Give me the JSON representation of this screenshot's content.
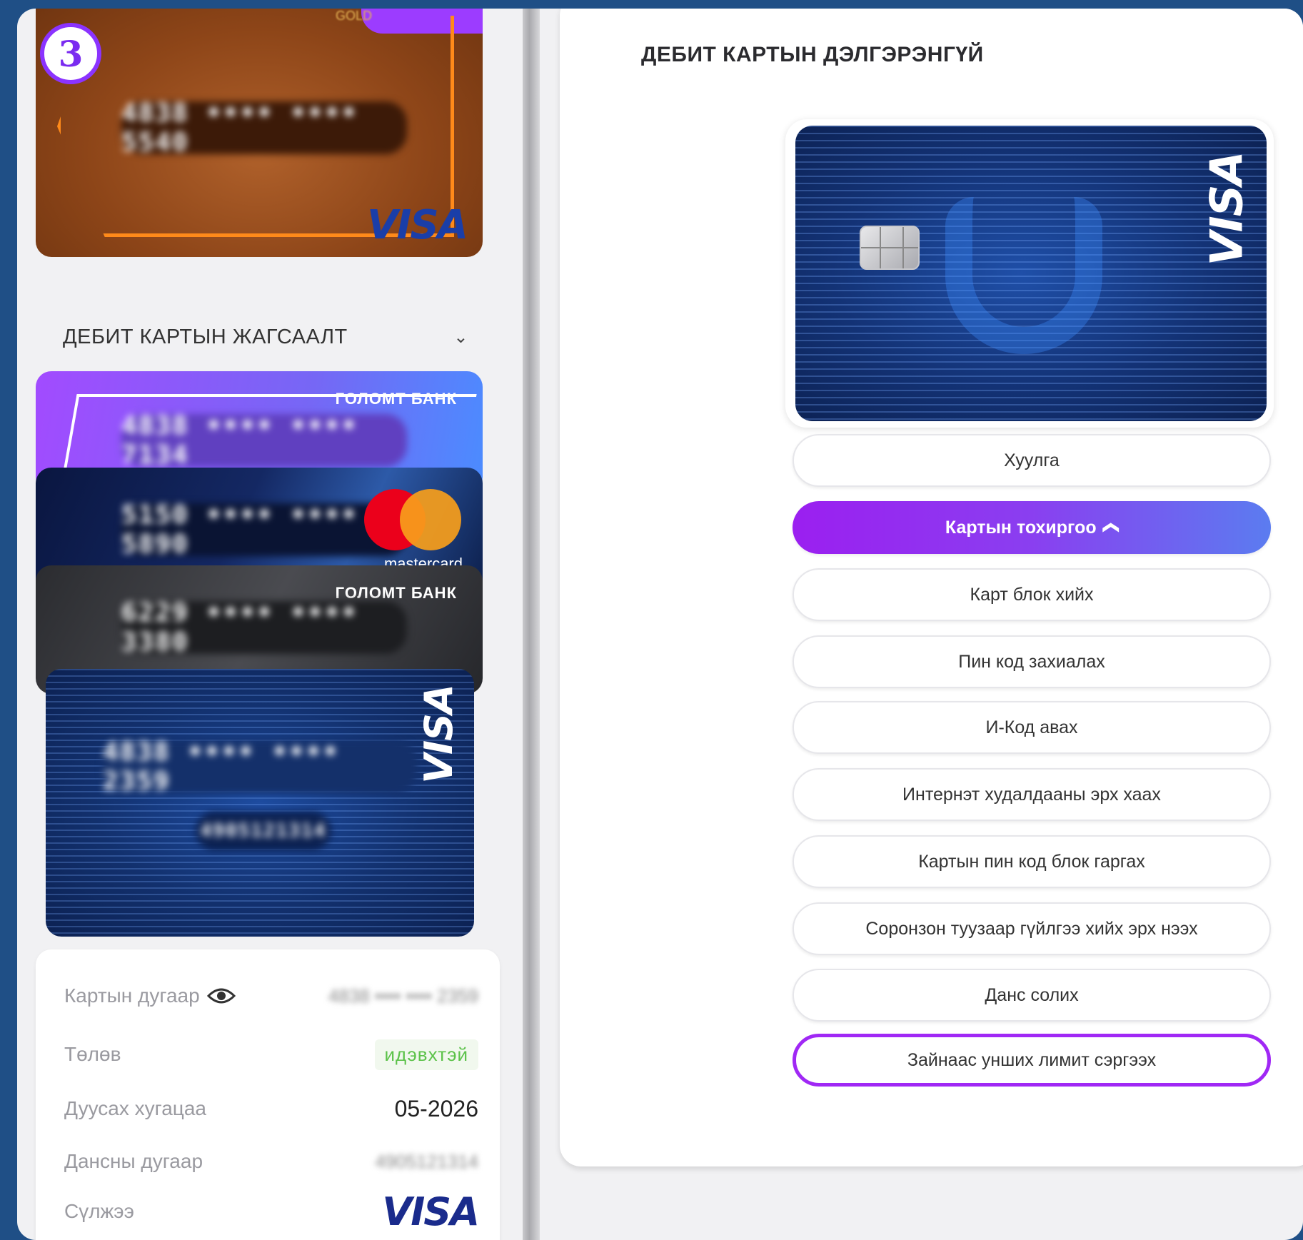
{
  "step_badge": "3",
  "left": {
    "gold_card": {
      "number": "4838 •••• •••• 5540",
      "network": "VISA",
      "logo": "GOLD"
    },
    "list_header": {
      "title": "ДЕБИТ КАРТЫН ЖАГСААЛТ",
      "chevron_icon": "chevron-down-icon"
    },
    "cards": [
      {
        "number": "4838 •••• •••• 7134",
        "bank": "ГОЛОМТ БАНК"
      },
      {
        "number": "5150 •••• •••• 5890",
        "network": "mastercard"
      },
      {
        "number": "6229 •••• •••• 3380",
        "bank": "ГОЛОМТ БАНК"
      },
      {
        "number": "4838 •••• •••• 2359",
        "account": "4905121314",
        "network": "VISA"
      }
    ],
    "info": {
      "card_number_label": "Картын дугаар",
      "card_number_value": "4838 •••• •••• 2359",
      "status_label": "Төлөв",
      "status_value": "идэвхтэй",
      "expiry_label": "Дуусах хугацаа",
      "expiry_value": "05-2026",
      "account_label": "Дансны дугаар",
      "account_value": "4905121314",
      "network_label": "Сүлжээ",
      "network_value": "VISA"
    }
  },
  "detail": {
    "title": "ДЕБИТ КАРТЫН ДЭЛГЭРЭНГҮЙ",
    "card_network": "VISA",
    "menu": [
      {
        "label": "Хуулга"
      },
      {
        "label": "Картын тохиргоо",
        "icon": "^"
      },
      {
        "label": "Карт блок хийх"
      },
      {
        "label": "Пин код захиалах"
      },
      {
        "label": "И-Код авах"
      },
      {
        "label": "Интернэт худалдааны эрх хаах"
      },
      {
        "label": "Картын пин код блок гаргах"
      },
      {
        "label": "Соронзон туузаар гүйлгээ хийх эрх нээх"
      },
      {
        "label": "Данс солих"
      },
      {
        "label": "Зайнаас унших лимит сэргээх"
      }
    ]
  },
  "colors": {
    "accent": "#9b1ff0",
    "highlight": "#a028f5",
    "background": "#1f4f86",
    "status_green": "#5cc24a"
  }
}
